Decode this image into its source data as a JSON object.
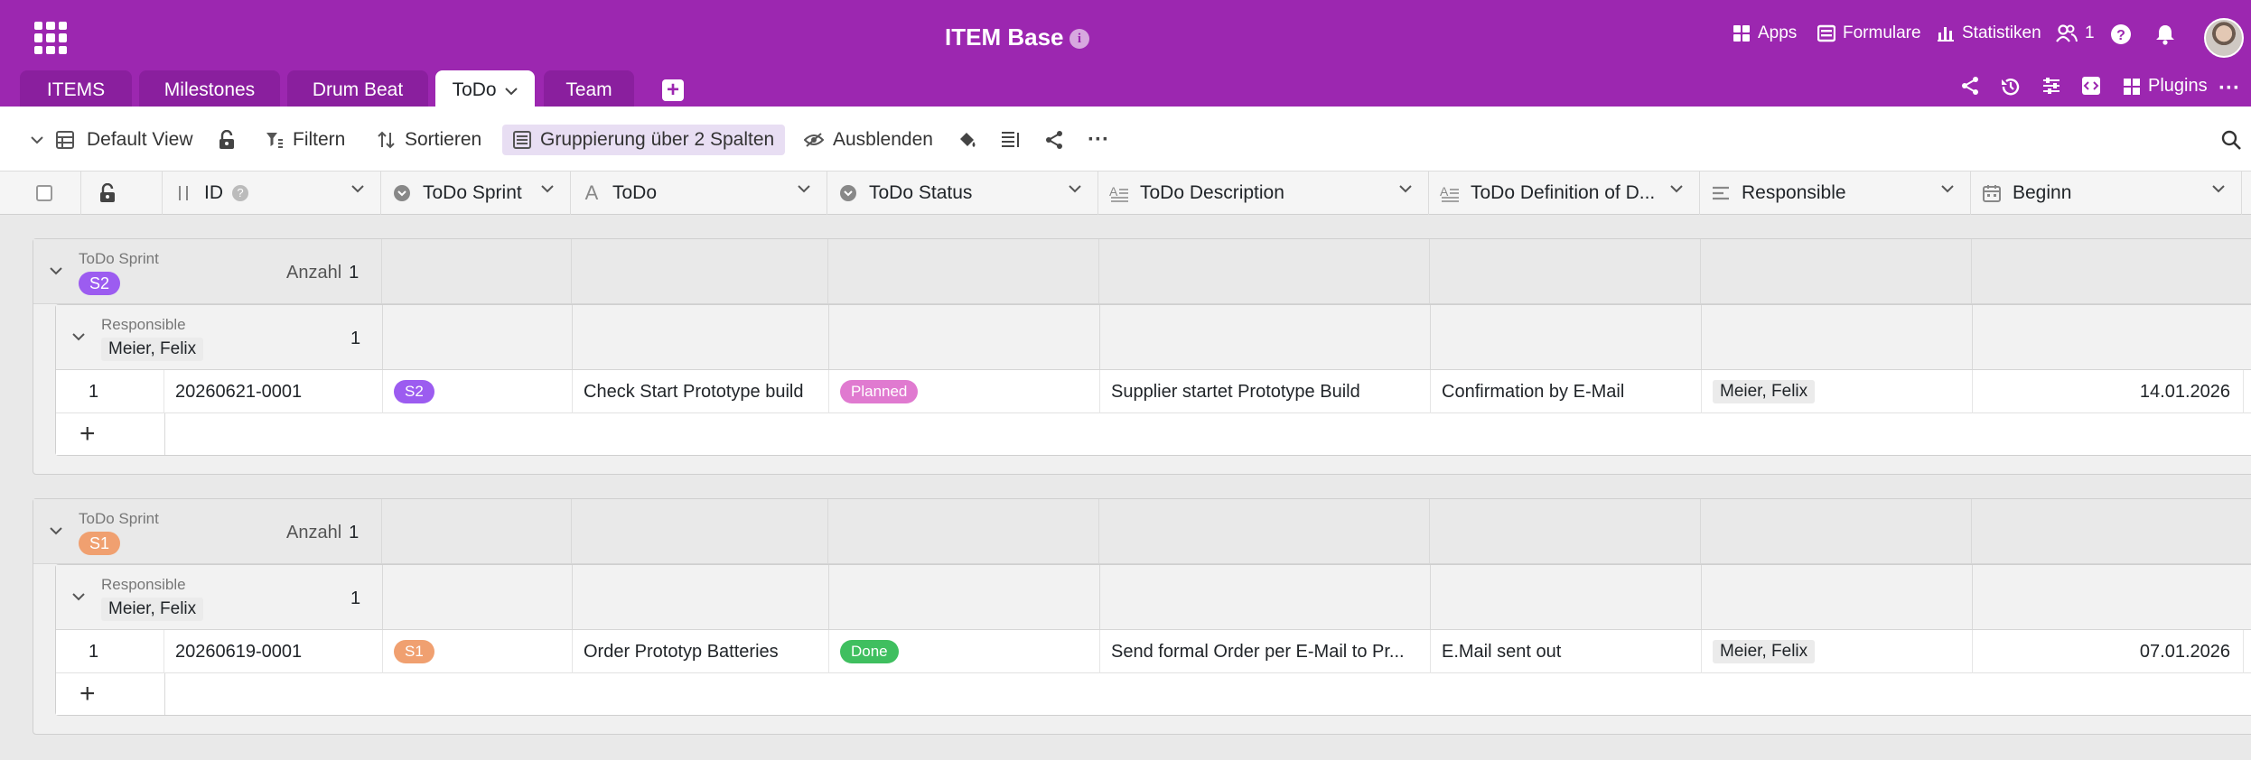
{
  "app": {
    "title": "ITEM Base",
    "info_icon": "i",
    "header_actions": [
      {
        "icon": "apps-icon",
        "label": "Apps"
      },
      {
        "icon": "form-icon",
        "label": "Formulare"
      },
      {
        "icon": "statistics-icon",
        "label": "Statistiken"
      },
      {
        "icon": "users-icon",
        "label": "1"
      }
    ],
    "colors": {
      "brand": "#9c27b0",
      "tab_bg": "#8a1f9e",
      "s2": "#9c5cf0",
      "s1": "#f0a070",
      "planned": "#e07ad0",
      "done": "#3fbf5f",
      "group_btn_bg": "#e8def3"
    }
  },
  "tabs": [
    {
      "label": "ITEMS",
      "active": false
    },
    {
      "label": "Milestones",
      "active": false
    },
    {
      "label": "Drum Beat",
      "active": false
    },
    {
      "label": "ToDo",
      "active": true
    },
    {
      "label": "Team",
      "active": false
    }
  ],
  "tab_tools": {
    "plugins_label": "Plugins",
    "more": "···"
  },
  "toolbar": {
    "view_label": "Default View",
    "filter_label": "Filtern",
    "sort_label": "Sortieren",
    "group_label": "Gruppierung über 2 Spalten",
    "hide_label": "Ausblenden",
    "more": "···"
  },
  "columns": [
    {
      "label": "ID",
      "icon": "sort-icon"
    },
    {
      "label": "ToDo Sprint",
      "icon": "single-select-icon"
    },
    {
      "label": "ToDo",
      "icon": "text-icon"
    },
    {
      "label": "ToDo Status",
      "icon": "single-select-icon"
    },
    {
      "label": "ToDo Description",
      "icon": "long-text-icon"
    },
    {
      "label": "ToDo Definition of D...",
      "icon": "long-text-icon"
    },
    {
      "label": "Responsible",
      "icon": "collaborator-icon"
    },
    {
      "label": "Beginn",
      "icon": "date-icon"
    }
  ],
  "groups": [
    {
      "field_label": "ToDo Sprint",
      "value": "S2",
      "count_label": "Anzahl",
      "count": "1",
      "sub_field_label": "Responsible",
      "sub_value": "Meier, Felix",
      "sub_count": "1",
      "row": {
        "index": "1",
        "id": "20260621-0001",
        "sprint": "S2",
        "todo": "Check Start Prototype build",
        "status": "Planned",
        "description": "Supplier startet Prototype Build",
        "definition": "Confirmation by E-Mail",
        "responsible": "Meier, Felix",
        "beginn": "14.01.2026"
      },
      "add_label": "+"
    },
    {
      "field_label": "ToDo Sprint",
      "value": "S1",
      "count_label": "Anzahl",
      "count": "1",
      "sub_field_label": "Responsible",
      "sub_value": "Meier, Felix",
      "sub_count": "1",
      "row": {
        "index": "1",
        "id": "20260619-0001",
        "sprint": "S1",
        "todo": "Order Prototyp Batteries",
        "status": "Done",
        "description": "Send formal Order per E-Mail to Pr...",
        "definition": "E.Mail sent out",
        "responsible": "Meier, Felix",
        "beginn": "07.01.2026"
      },
      "add_label": "+"
    }
  ]
}
